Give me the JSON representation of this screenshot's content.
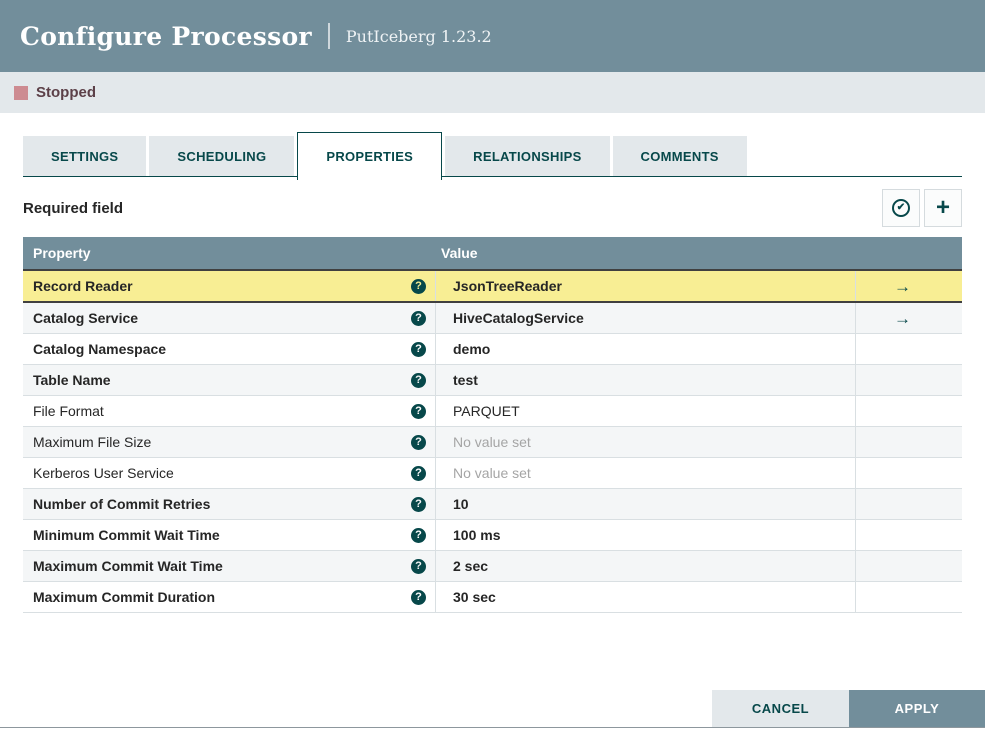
{
  "dialog": {
    "title": "Configure Processor",
    "subtitle": "PutIceberg 1.23.2",
    "status": {
      "label": "Stopped",
      "color": "#CD8B91"
    }
  },
  "tabs": [
    {
      "label": "SETTINGS",
      "active": false
    },
    {
      "label": "SCHEDULING",
      "active": false
    },
    {
      "label": "PROPERTIES",
      "active": true
    },
    {
      "label": "RELATIONSHIPS",
      "active": false
    },
    {
      "label": "COMMENTS",
      "active": false
    }
  ],
  "properties_tab": {
    "required_field_label": "Required field",
    "toolbar": {
      "verify_icon_glyph": "✔",
      "add_icon_glyph": "+"
    },
    "table": {
      "columns": [
        "Property",
        "Value"
      ],
      "rows": [
        {
          "property": "Record Reader",
          "value": "JsonTreeReader",
          "required": true,
          "highlighted": true,
          "has_goto": true,
          "empty": false
        },
        {
          "property": "Catalog Service",
          "value": "HiveCatalogService",
          "required": true,
          "highlighted": false,
          "has_goto": true,
          "empty": false
        },
        {
          "property": "Catalog Namespace",
          "value": "demo",
          "required": true,
          "highlighted": false,
          "has_goto": false,
          "empty": false
        },
        {
          "property": "Table Name",
          "value": "test",
          "required": true,
          "highlighted": false,
          "has_goto": false,
          "empty": false
        },
        {
          "property": "File Format",
          "value": "PARQUET",
          "required": false,
          "highlighted": false,
          "has_goto": false,
          "empty": false
        },
        {
          "property": "Maximum File Size",
          "value": "No value set",
          "required": false,
          "highlighted": false,
          "has_goto": false,
          "empty": true
        },
        {
          "property": "Kerberos User Service",
          "value": "No value set",
          "required": false,
          "highlighted": false,
          "has_goto": false,
          "empty": true
        },
        {
          "property": "Number of Commit Retries",
          "value": "10",
          "required": true,
          "highlighted": false,
          "has_goto": false,
          "empty": false
        },
        {
          "property": "Minimum Commit Wait Time",
          "value": "100 ms",
          "required": true,
          "highlighted": false,
          "has_goto": false,
          "empty": false
        },
        {
          "property": "Maximum Commit Wait Time",
          "value": "2 sec",
          "required": true,
          "highlighted": false,
          "has_goto": false,
          "empty": false
        },
        {
          "property": "Maximum Commit Duration",
          "value": "30 sec",
          "required": true,
          "highlighted": false,
          "has_goto": false,
          "empty": false
        }
      ]
    },
    "icons": {
      "help_glyph": "?",
      "goto_glyph": "→"
    }
  },
  "footer": {
    "cancel_label": "CANCEL",
    "apply_label": "APPLY"
  },
  "colors": {
    "header_bg": "#728E9B",
    "panel_bg": "#E3E8EB",
    "accent_teal": "#07484A",
    "highlight_yellow": "#F8EE94",
    "stopped_red": "#CD8B91"
  }
}
